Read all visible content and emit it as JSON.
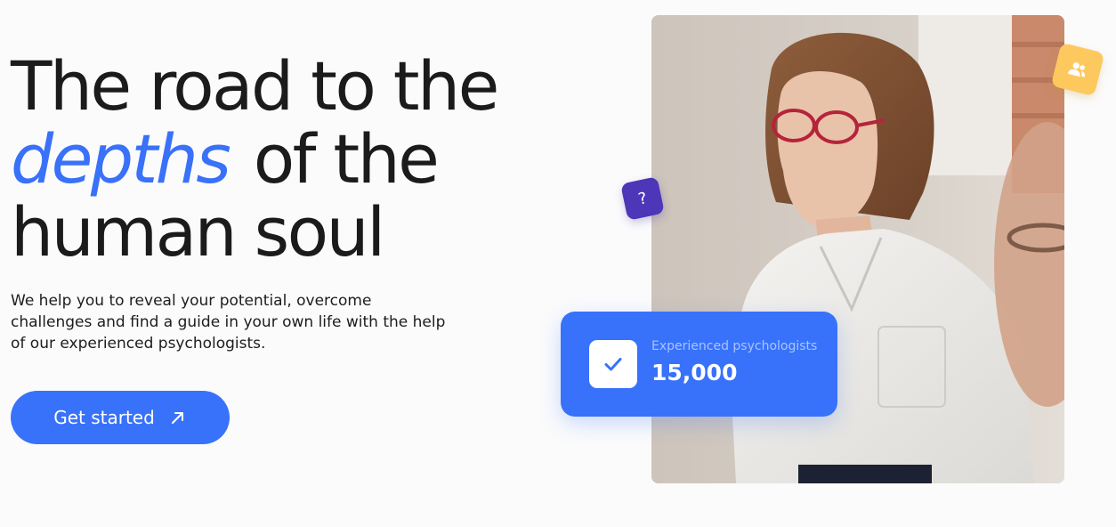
{
  "hero": {
    "headline_line1": "The road to the",
    "headline_accent": "depths",
    "headline_line2_rest": "of the",
    "headline_line3": "human soul",
    "description": "We help you to reveal your potential, overcome challenges and find a guide in your own life with the help of our experienced psychologists.",
    "cta_label": "Get started",
    "cta_icon": "arrow-up-right-icon"
  },
  "badges": {
    "question_icon": "question-icon",
    "question_glyph": "?",
    "users_icon": "users-icon"
  },
  "stat_card": {
    "icon": "check-icon",
    "label": "Experienced psychologists",
    "value": "15,000"
  },
  "colors": {
    "accent_blue": "#3872fb",
    "headline_accent": "#3971f8",
    "question_badge": "#4d36b8",
    "users_badge": "#fdc95f",
    "text_dark": "#1b1b1b",
    "background": "#fbfbfc"
  }
}
